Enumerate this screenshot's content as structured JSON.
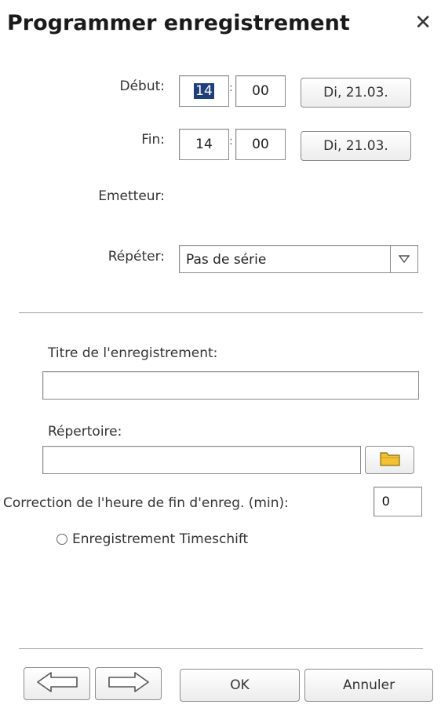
{
  "dialog": {
    "title": "Programmer enregistrement",
    "close_symbol": "✕"
  },
  "start": {
    "label": "Début:",
    "hour": "14",
    "minute": "00",
    "date": "Di, 21.03."
  },
  "end": {
    "label": "Fin:",
    "hour": "14",
    "minute": "00",
    "date": "Di, 21.03."
  },
  "channel": {
    "label": "Emetteur:"
  },
  "repeat": {
    "label": "Répéter:",
    "value": "Pas de série"
  },
  "recording_title": {
    "label": "Titre de l'enregistrement:",
    "value": ""
  },
  "directory": {
    "label": "Répertoire:",
    "value": "",
    "icon": "folder-icon"
  },
  "end_correction": {
    "label": "Correction de l'heure de fin d'enreg. (min):",
    "value": "0"
  },
  "timeshift": {
    "label": "Enregistrement Timeschift",
    "checked": false
  },
  "footer": {
    "back_icon": "arrow-left-icon",
    "forward_icon": "arrow-right-icon",
    "ok_label": "OK",
    "cancel_label": "Annuler"
  },
  "colors": {
    "selection": "#1f3f7a",
    "folder": "#f2c233",
    "border": "#8a8a8a"
  }
}
